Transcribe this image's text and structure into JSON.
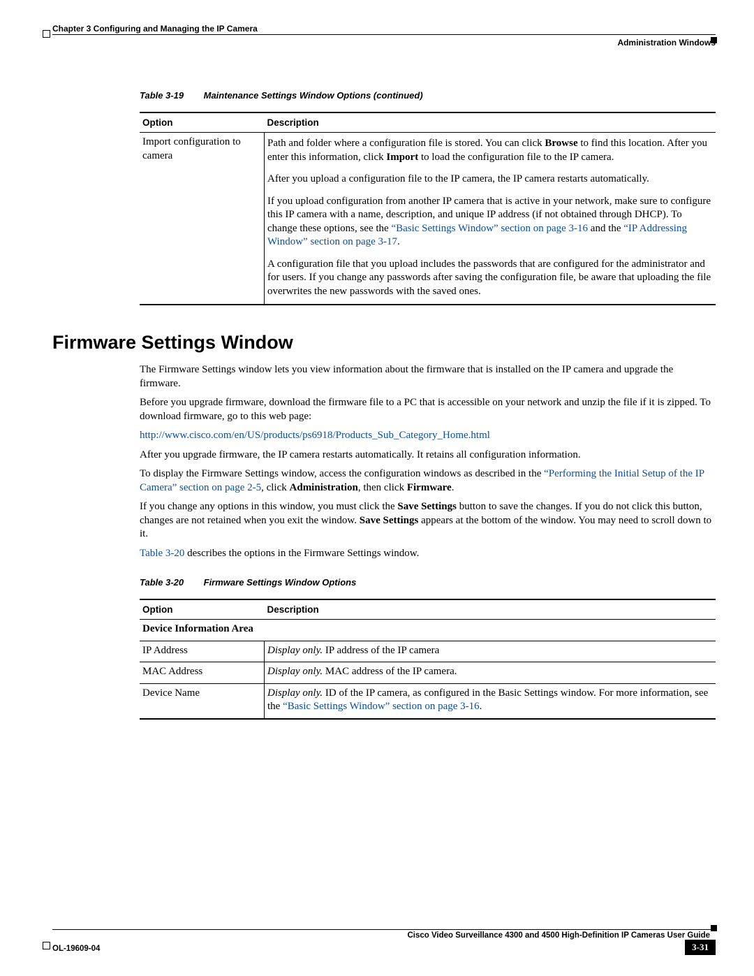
{
  "header": {
    "chapter": "Chapter 3      Configuring and Managing the IP Camera",
    "section": "Administration Windows"
  },
  "table19": {
    "label": "Table 3-19",
    "title": "Maintenance Settings Window Options (continued)",
    "headers": {
      "option": "Option",
      "description": "Description"
    },
    "row": {
      "option": "Import configuration to camera",
      "p1a": "Path and folder where a configuration file is stored. You can click ",
      "p1b": "Browse",
      "p1c": " to find this location. After you enter this information, click ",
      "p1d": "Import",
      "p1e": " to load the configuration file to the IP camera.",
      "p2": "After you upload a configuration file to the IP camera, the IP camera restarts automatically.",
      "p3a": "If you upload configuration from another IP camera that is active in your network, make sure to configure this IP camera with a name, description, and unique IP address (if not obtained through DHCP). To change these options, see the ",
      "p3link1": "“Basic Settings Window” section on page 3-16",
      "p3b": " and the ",
      "p3link2": "“IP Addressing Window” section on page 3-17",
      "p3c": ".",
      "p4": "A configuration file that you upload includes the passwords that are configured for the administrator and for users. If you change any passwords after saving the configuration file, be aware that uploading the file overwrites the new passwords with the saved ones."
    }
  },
  "heading": "Firmware Settings Window",
  "paras": {
    "p1": "The Firmware Settings window lets you view information about the firmware that is installed on the IP camera and upgrade the firmware.",
    "p2": "Before you upgrade firmware, download the firmware file to a PC that is accessible on your network and unzip the file if it is zipped. To download firmware, go to this web page:",
    "link": "http://www.cisco.com/en/US/products/ps6918/Products_Sub_Category_Home.html",
    "p3": "After you upgrade firmware, the IP camera restarts automatically. It retains all configuration information.",
    "p4a": "To display the Firmware Settings window, access the configuration windows as described in the ",
    "p4link": "“Performing the Initial Setup of the IP Camera” section on page 2-5",
    "p4b": ", click ",
    "p4bold1": "Administration",
    "p4c": ", then click ",
    "p4bold2": "Firmware",
    "p4d": ".",
    "p5a": "If you change any options in this window, you must click the ",
    "p5bold1": "Save Settings",
    "p5b": " button to save the changes. If you do not click this button, changes are not retained when you exit the window. ",
    "p5bold2": "Save Settings",
    "p5c": " appears at the bottom of the window. You may need to scroll down to it.",
    "p6link": "Table 3-20",
    "p6": " describes the options in the Firmware Settings window."
  },
  "table20": {
    "label": "Table 3-20",
    "title": "Firmware Settings Window Options",
    "headers": {
      "option": "Option",
      "description": "Description"
    },
    "sectionHeader": "Device Information Area",
    "rows": [
      {
        "option": "IP Address",
        "prefix": "Display only.",
        "text": " IP address of the IP camera"
      },
      {
        "option": "MAC Address",
        "prefix": "Display only.",
        "text": " MAC address of the IP camera."
      },
      {
        "option": "Device Name",
        "prefix": "Display only.",
        "textA": " ID of the IP camera, as configured in the Basic Settings window. For more information, see the ",
        "link": "“Basic Settings Window” section on page 3-16",
        "textB": "."
      }
    ]
  },
  "footer": {
    "title": "Cisco Video Surveillance 4300 and 4500 High-Definition IP Cameras User Guide",
    "doc": "OL-19609-04",
    "page": "3-31"
  }
}
